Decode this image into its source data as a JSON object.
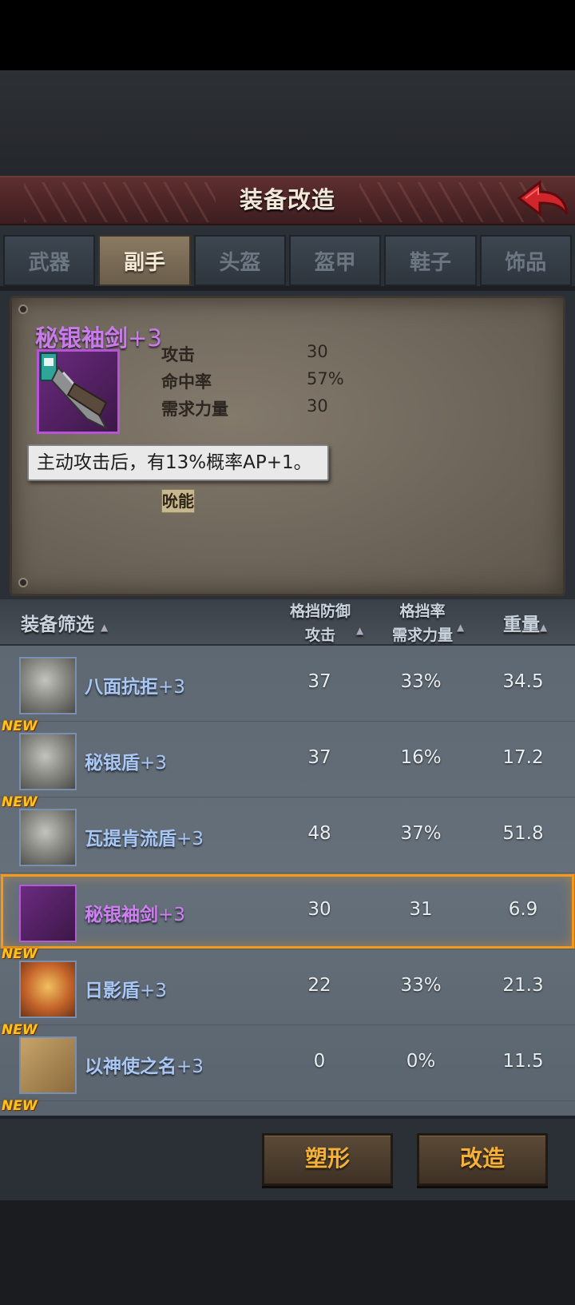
{
  "title": "装备改造",
  "tabs": [
    "武器",
    "副手",
    "头盔",
    "盔甲",
    "鞋子",
    "饰品"
  ],
  "active_tab": "副手",
  "selected_item": {
    "name": "秘银袖剑",
    "level": "+3",
    "stats": [
      {
        "label": "攻击",
        "value": "30"
      },
      {
        "label": "命中率",
        "value": "57%"
      },
      {
        "label": "需求力量",
        "value": "30"
      }
    ],
    "tooltip": "主动攻击后，有13%概率AP+1。",
    "trait": "吮能"
  },
  "list_header": {
    "filter": "装备筛选",
    "col1_top": "格挡防御",
    "col1_bottom": "攻击",
    "col2_top": "格挡率",
    "col2_bottom": "需求力量",
    "col3": "重量"
  },
  "items": [
    {
      "name": "八面抗拒",
      "level": "+3",
      "v1": "37",
      "v2": "33%",
      "v3": "34.5",
      "new": "",
      "icon": "shield-icon"
    },
    {
      "name": "秘银盾",
      "level": "+3",
      "v1": "37",
      "v2": "16%",
      "v3": "17.2",
      "new": "NEW",
      "icon": "shield-icon"
    },
    {
      "name": "瓦提肯流盾",
      "level": "+3",
      "v1": "48",
      "v2": "37%",
      "v3": "51.8",
      "new": "NEW",
      "icon": "shield-icon"
    },
    {
      "name": "秘银袖剑",
      "level": "+3",
      "v1": "30",
      "v2": "31",
      "v3": "6.9",
      "new": "",
      "icon": "sleeve-blade-icon"
    },
    {
      "name": "日影盾",
      "level": "+3",
      "v1": "22",
      "v2": "33%",
      "v3": "21.3",
      "new": "NEW",
      "icon": "sun-shield-icon"
    },
    {
      "name": "以神使之名",
      "level": "+3",
      "v1": "0",
      "v2": "0%",
      "v3": "11.5",
      "new": "NEW",
      "icon": "tome-icon"
    }
  ],
  "partial_badge": "NEW",
  "buttons": {
    "reshape": "塑形",
    "modify": "改造"
  },
  "colors": {
    "accent_orange": "#f29a1d",
    "purple_rarity": "#c87ce8",
    "blue_name": "#a9c7f3"
  }
}
